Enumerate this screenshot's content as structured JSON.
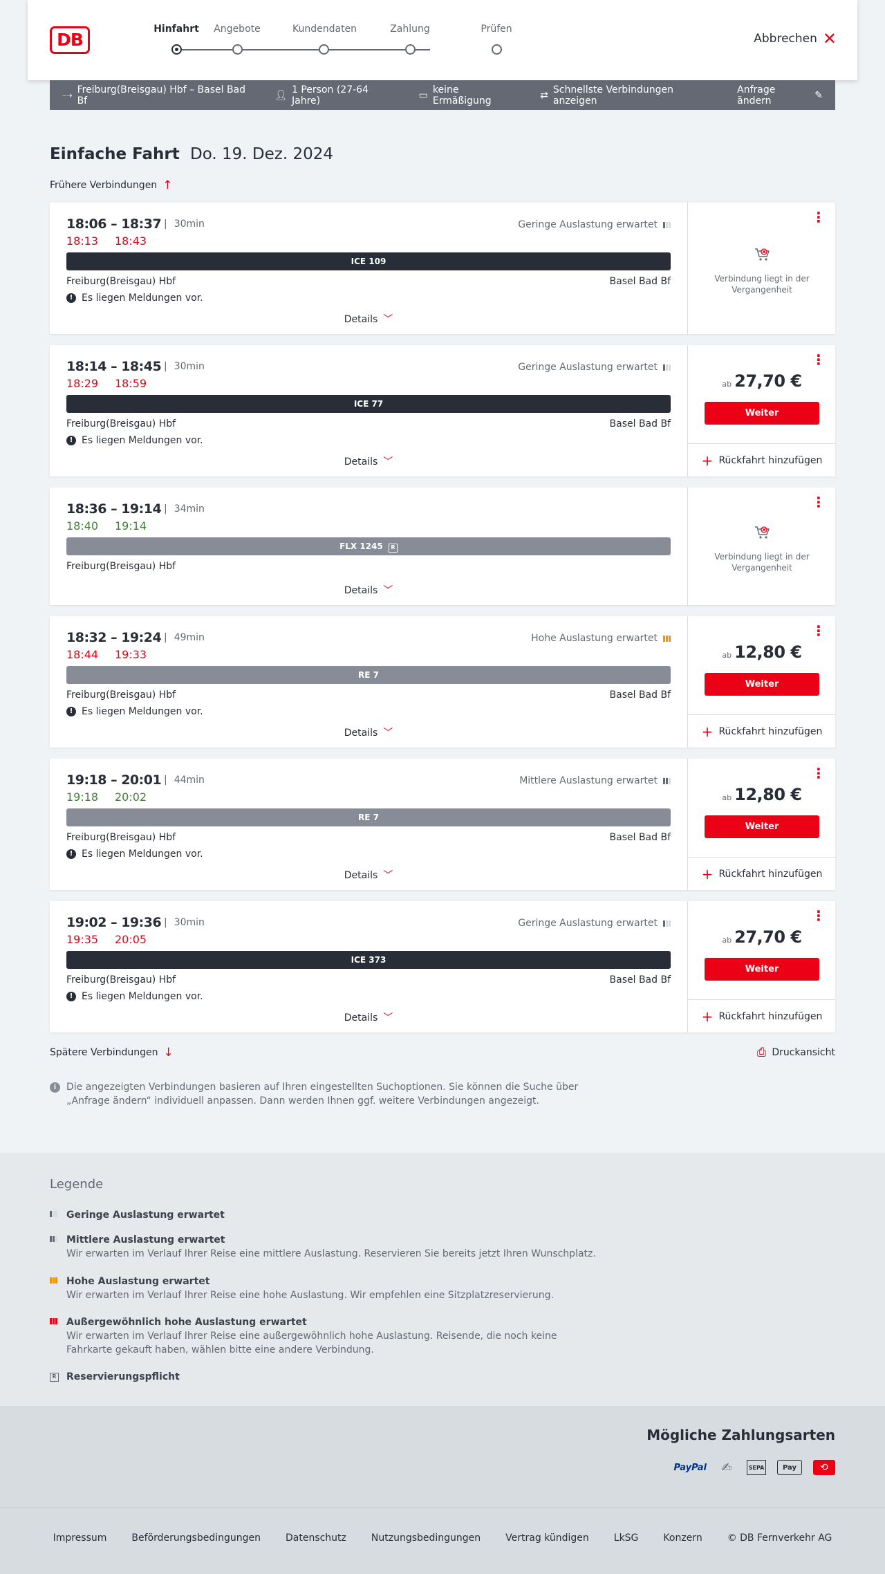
{
  "header": {
    "logo": "DB",
    "steps": [
      "Hinfahrt",
      "Angebote",
      "Kundendaten",
      "Zahlung",
      "Prüfen"
    ],
    "active_step": "Hinfahrt",
    "cancel_label": "Abbrechen"
  },
  "search": {
    "route": "Freiburg(Breisgau) Hbf – Basel Bad Bf",
    "passengers": "1 Person (27-64 Jahre)",
    "discount": "keine Ermäßigung",
    "fastest": "Schnellste Verbindungen anzeigen",
    "edit": "Anfrage ändern"
  },
  "title": {
    "type": "Einfache Fahrt",
    "date": "Do. 19. Dez. 2024"
  },
  "earlier_label": "Frühere Verbindungen",
  "later_label": "Spätere Verbindungen",
  "print_label": "Druckansicht",
  "details_label": "Details",
  "weiter_label": "Weiter",
  "return_label": "Rückfahrt hinzufügen",
  "price_prefix": "ab",
  "past_label": "Verbindung liegt in der Vergangenheit",
  "message_label": "Es liegen Meldungen vor.",
  "connections": [
    {
      "times": "18:06 – 18:37",
      "duration": "30min",
      "rt_dep": "18:13",
      "rt_arr": "18:43",
      "rt_status": "late",
      "occupancy": "Geringe Auslastung erwartet",
      "occ_level": 1,
      "train": "ICE 109",
      "train_kind": "ice",
      "from": "Freiburg(Breisgau) Hbf",
      "to": "Basel Bad Bf",
      "has_message": true,
      "past": true,
      "price": ""
    },
    {
      "times": "18:14 – 18:45",
      "duration": "30min",
      "rt_dep": "18:29",
      "rt_arr": "18:59",
      "rt_status": "late",
      "occupancy": "Geringe Auslastung erwartet",
      "occ_level": 1,
      "train": "ICE 77",
      "train_kind": "ice",
      "from": "Freiburg(Breisgau) Hbf",
      "to": "Basel Bad Bf",
      "has_message": true,
      "past": false,
      "price": "27,70 €"
    },
    {
      "times": "18:36 – 19:14",
      "duration": "34min",
      "rt_dep": "18:40",
      "rt_arr": "19:14",
      "rt_status": "ontime",
      "occupancy": "",
      "occ_level": 0,
      "train": "FLX 1245",
      "train_kind": "reg",
      "reservation": "R",
      "from": "Freiburg(Breisgau) Hbf",
      "to": "",
      "has_message": false,
      "past": true,
      "price": ""
    },
    {
      "times": "18:32 – 19:24",
      "duration": "49min",
      "rt_dep": "18:44",
      "rt_arr": "19:33",
      "rt_status": "late",
      "occupancy": "Hohe Auslastung erwartet",
      "occ_level": 3,
      "train": "RE 7",
      "train_kind": "reg",
      "from": "Freiburg(Breisgau) Hbf",
      "to": "Basel Bad Bf",
      "has_message": true,
      "past": false,
      "price": "12,80 €"
    },
    {
      "times": "19:18 – 20:01",
      "duration": "44min",
      "rt_dep": "19:18",
      "rt_arr": "20:02",
      "rt_status": "ontime",
      "occupancy": "Mittlere Auslastung erwartet",
      "occ_level": 2,
      "train": "RE 7",
      "train_kind": "reg",
      "from": "Freiburg(Breisgau) Hbf",
      "to": "Basel Bad Bf",
      "has_message": true,
      "past": false,
      "price": "12,80 €"
    },
    {
      "times": "19:02 – 19:36",
      "duration": "30min",
      "rt_dep": "19:35",
      "rt_arr": "20:05",
      "rt_status": "late",
      "occupancy": "Geringe Auslastung erwartet",
      "occ_level": 1,
      "train": "ICE 373",
      "train_kind": "ice",
      "from": "Freiburg(Breisgau) Hbf",
      "to": "Basel Bad Bf",
      "has_message": true,
      "past": false,
      "price": "27,70 €"
    }
  ],
  "info_text": "Die angezeigten Verbindungen basieren auf Ihren eingestellten Suchoptionen. Sie können die Suche über „Anfrage ändern“ individuell anpassen. Dann werden Ihnen ggf. weitere Verbindungen angezeigt.",
  "legend": {
    "title": "Legende",
    "items": [
      {
        "title": "Geringe Auslastung erwartet",
        "text": ""
      },
      {
        "title": "Mittlere Auslastung erwartet",
        "text": "Wir erwarten im Verlauf Ihrer Reise eine mittlere Auslastung. Reservieren Sie bereits jetzt Ihren Wunschplatz."
      },
      {
        "title": "Hohe Auslastung erwartet",
        "text": "Wir erwarten im Verlauf Ihrer Reise eine hohe Auslastung. Wir empfehlen eine Sitzplatzreservierung."
      },
      {
        "title": "Außergewöhnlich hohe Auslastung erwartet",
        "text": "Wir erwarten im Verlauf Ihrer Reise eine außergewöhnlich hohe Auslastung. Reisende, die noch keine Fahrkarte gekauft haben, wählen bitte eine andere Verbindung."
      },
      {
        "title": "Reservierungspflicht",
        "text": ""
      }
    ]
  },
  "payment": {
    "title": "Mögliche Zahlungsarten",
    "methods": [
      "PayPal",
      "Kreditkarte",
      "SEPA",
      "Apple Pay",
      "DB Bonus"
    ]
  },
  "footer": {
    "links": [
      "Impressum",
      "Beförderungsbedingungen",
      "Datenschutz",
      "Nutzungsbedingungen",
      "Vertrag kündigen",
      "LkSG",
      "Konzern"
    ],
    "copyright": "© DB Fernverkehr AG"
  },
  "colors": {
    "brand_red": "#ec0016",
    "dark": "#282d37",
    "grey": "#646973",
    "ontime_green": "#408335",
    "high_occ": "#f39200"
  }
}
